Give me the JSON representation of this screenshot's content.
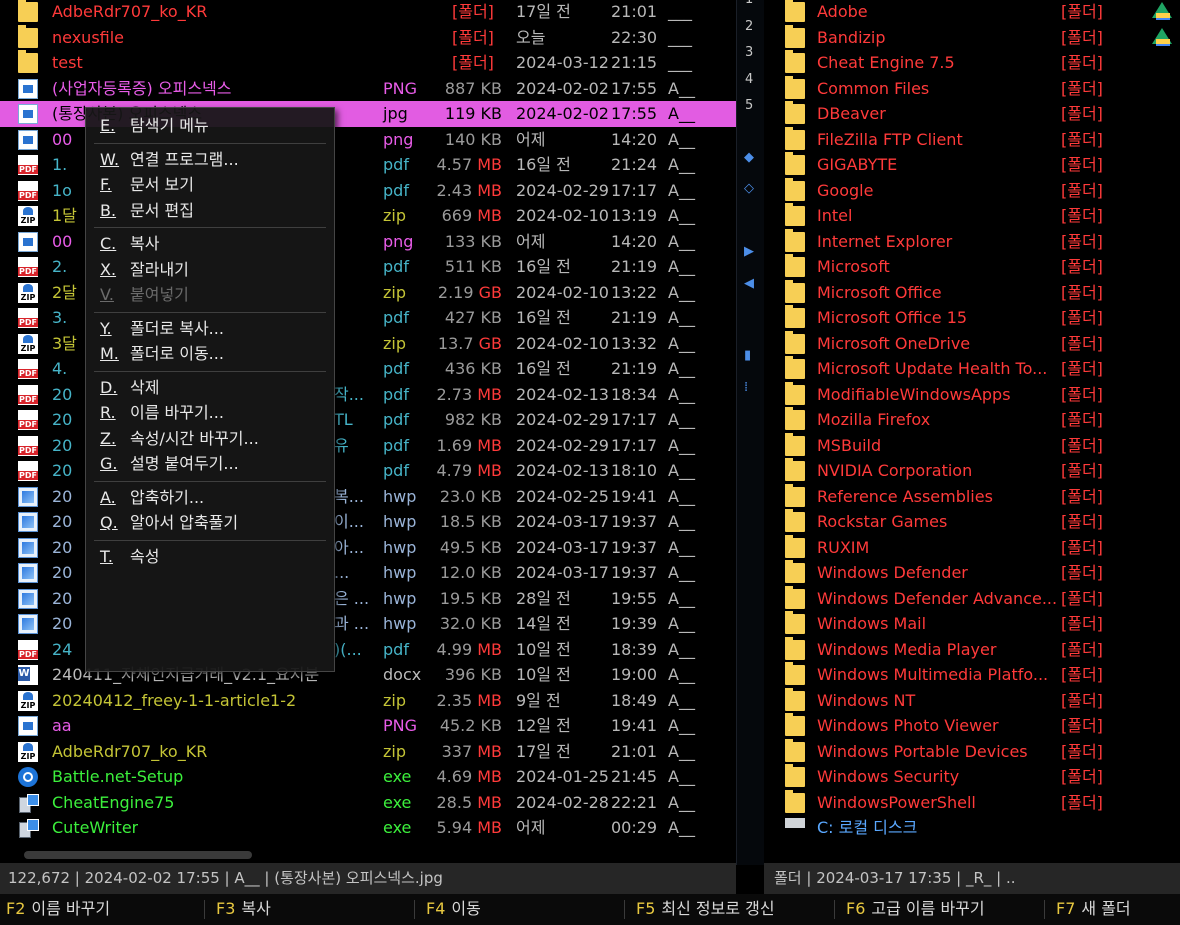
{
  "left_pane": {
    "rows": [
      {
        "name": "AdbeRdr707_ko_KR",
        "ext": "",
        "size": "[폴더]",
        "date": "17일 전",
        "time": "21:01",
        "attr": "___",
        "icon": "folder-icon",
        "color": "red",
        "folder": true
      },
      {
        "name": "nexusfile",
        "ext": "",
        "size": "[폴더]",
        "date": "오늘",
        "time": "22:30",
        "attr": "___",
        "icon": "folder-icon",
        "color": "red",
        "folder": true
      },
      {
        "name": "test",
        "ext": "",
        "size": "[폴더]",
        "date": "2024-03-12",
        "time": "21:15",
        "attr": "___",
        "icon": "folder-icon",
        "color": "red",
        "folder": true
      },
      {
        "name": "(사업자등록증) 오피스넥스",
        "ext": "PNG",
        "size_num": "887",
        "size_unit": "KB",
        "date": "2024-02-02",
        "time": "17:55",
        "attr": "A__",
        "icon": "image-file-icon",
        "color": "magenta"
      },
      {
        "name": "(통장사본) 오피스넥스",
        "ext": "jpg",
        "size_num": "119",
        "size_unit": "KB",
        "date": "2024-02-02",
        "time": "17:55",
        "attr": "A__",
        "icon": "image-file-icon",
        "color": "magenta",
        "selected": true
      },
      {
        "name": "00",
        "ext": "png",
        "size_num": "140",
        "size_unit": "KB",
        "date": "어제",
        "time": "14:20",
        "attr": "A__",
        "icon": "image-file-icon",
        "color": "magenta"
      },
      {
        "name": "1.",
        "ext": "pdf",
        "size_num": "4.57",
        "size_unit": "MB",
        "date": "16일 전",
        "time": "21:24",
        "attr": "A__",
        "icon": "pdf-file-icon",
        "color": "teal"
      },
      {
        "name": "1o",
        "ext": "pdf",
        "size_num": "2.43",
        "size_unit": "MB",
        "date": "2024-02-29",
        "time": "17:17",
        "attr": "A__",
        "icon": "pdf-file-icon",
        "color": "teal"
      },
      {
        "name": "1달",
        "ext": "zip",
        "size_num": "669",
        "size_unit": "MB",
        "date": "2024-02-10",
        "time": "13:19",
        "attr": "A__",
        "icon": "zip-file-icon",
        "color": "olive"
      },
      {
        "name": "00",
        "ext": "png",
        "size_num": "133",
        "size_unit": "KB",
        "date": "어제",
        "time": "14:20",
        "attr": "A__",
        "icon": "image-file-icon",
        "color": "magenta"
      },
      {
        "name": "2.",
        "ext": "pdf",
        "size_num": "511",
        "size_unit": "KB",
        "date": "16일 전",
        "time": "21:19",
        "attr": "A__",
        "icon": "pdf-file-icon",
        "color": "teal"
      },
      {
        "name": "2달",
        "ext": "zip",
        "size_num": "2.19",
        "size_unit": "GB",
        "date": "2024-02-10",
        "time": "13:22",
        "attr": "A__",
        "icon": "zip-file-icon",
        "color": "olive"
      },
      {
        "name": "3.",
        "ext": "pdf",
        "size_num": "427",
        "size_unit": "KB",
        "date": "16일 전",
        "time": "21:19",
        "attr": "A__",
        "icon": "pdf-file-icon",
        "color": "teal"
      },
      {
        "name": "3달",
        "ext": "zip",
        "size_num": "13.7",
        "size_unit": "GB",
        "date": "2024-02-10",
        "time": "13:32",
        "attr": "A__",
        "icon": "zip-file-icon",
        "color": "olive"
      },
      {
        "name": "4.",
        "ext": "pdf",
        "size_num": "436",
        "size_unit": "KB",
        "date": "16일 전",
        "time": "21:19",
        "attr": "A__",
        "icon": "pdf-file-icon",
        "color": "teal"
      },
      {
        "name": "20",
        "ext": "pdf",
        "size_num": "2.73",
        "size_unit": "MB",
        "date": "2024-02-13",
        "time": "18:34",
        "attr": "A__",
        "icon": "pdf-file-icon",
        "color": "teal",
        "trail": "작..."
      },
      {
        "name": "20",
        "ext": "pdf",
        "size_num": "982",
        "size_unit": "KB",
        "date": "2024-02-29",
        "time": "17:17",
        "attr": "A__",
        "icon": "pdf-file-icon",
        "color": "teal",
        "trail": "TL"
      },
      {
        "name": "20",
        "ext": "pdf",
        "size_num": "1.69",
        "size_unit": "MB",
        "date": "2024-02-29",
        "time": "17:17",
        "attr": "A__",
        "icon": "pdf-file-icon",
        "color": "teal",
        "trail": "유"
      },
      {
        "name": "20",
        "ext": "pdf",
        "size_num": "4.79",
        "size_unit": "MB",
        "date": "2024-02-13",
        "time": "18:10",
        "attr": "A__",
        "icon": "pdf-file-icon",
        "color": "teal"
      },
      {
        "name": "20",
        "ext": "hwp",
        "size_num": "23.0",
        "size_unit": "KB",
        "date": "2024-02-25",
        "time": "19:41",
        "attr": "A__",
        "icon": "hwp-file-icon",
        "color": "hwp",
        "trail": "복..."
      },
      {
        "name": "20",
        "ext": "hwp",
        "size_num": "18.5",
        "size_unit": "KB",
        "date": "2024-03-17",
        "time": "19:37",
        "attr": "A__",
        "icon": "hwp-file-icon",
        "color": "hwp",
        "trail": "이..."
      },
      {
        "name": "20",
        "ext": "hwp",
        "size_num": "49.5",
        "size_unit": "KB",
        "date": "2024-03-17",
        "time": "19:37",
        "attr": "A__",
        "icon": "hwp-file-icon",
        "color": "hwp",
        "trail": "아..."
      },
      {
        "name": "20",
        "ext": "hwp",
        "size_num": "12.0",
        "size_unit": "KB",
        "date": "2024-03-17",
        "time": "19:37",
        "attr": "A__",
        "icon": "hwp-file-icon",
        "color": "hwp",
        "trail": "..."
      },
      {
        "name": "20",
        "ext": "hwp",
        "size_num": "19.5",
        "size_unit": "KB",
        "date": "28일 전",
        "time": "19:55",
        "attr": "A__",
        "icon": "hwp-file-icon",
        "color": "hwp",
        "trail": "은 ..."
      },
      {
        "name": "20",
        "ext": "hwp",
        "size_num": "32.0",
        "size_unit": "KB",
        "date": "14일 전",
        "time": "19:39",
        "attr": "A__",
        "icon": "hwp-file-icon",
        "color": "hwp",
        "trail": "과 ..."
      },
      {
        "name": "24",
        "ext": "pdf",
        "size_num": "4.99",
        "size_unit": "MB",
        "date": "10일 전",
        "time": "18:39",
        "attr": "A__",
        "icon": "pdf-file-icon",
        "color": "teal",
        "trail": ")(..."
      },
      {
        "name": "240411_자체인지급거래_v2.1_요지분",
        "ext": "docx",
        "size_num": "396",
        "size_unit": "KB",
        "date": "10일 전",
        "time": "19:00",
        "attr": "A__",
        "icon": "word-file-icon",
        "color": "doc"
      },
      {
        "name": "20240412_freey-1-1-article1-2",
        "ext": "zip",
        "size_num": "2.35",
        "size_unit": "MB",
        "date": "9일 전",
        "time": "18:49",
        "attr": "A__",
        "icon": "zip-file-icon",
        "color": "olive"
      },
      {
        "name": "aa",
        "ext": "PNG",
        "size_num": "45.2",
        "size_unit": "KB",
        "date": "12일 전",
        "time": "19:41",
        "attr": "A__",
        "icon": "image-file-icon",
        "color": "magenta"
      },
      {
        "name": "AdbeRdr707_ko_KR",
        "ext": "zip",
        "size_num": "337",
        "size_unit": "MB",
        "date": "17일 전",
        "time": "21:01",
        "attr": "A__",
        "icon": "zip-file-icon",
        "color": "olive"
      },
      {
        "name": "Battle.net-Setup",
        "ext": "exe",
        "size_num": "4.69",
        "size_unit": "MB",
        "date": "2024-01-25",
        "time": "21:45",
        "attr": "A__",
        "icon": "battlenet-icon",
        "color": "green"
      },
      {
        "name": "CheatEngine75",
        "ext": "exe",
        "size_num": "28.5",
        "size_unit": "MB",
        "date": "2024-02-28",
        "time": "22:21",
        "attr": "A__",
        "icon": "setup-icon",
        "color": "green"
      },
      {
        "name": "CuteWriter",
        "ext": "exe",
        "size_num": "5.94",
        "size_unit": "MB",
        "date": "어제",
        "time": "00:29",
        "attr": "A__",
        "icon": "setup-icon",
        "color": "green"
      }
    ]
  },
  "context_menu": {
    "items": [
      {
        "key": "E.",
        "label": "탐색기 메뉴"
      },
      {
        "sep": true
      },
      {
        "key": "W.",
        "label": "연결 프로그램..."
      },
      {
        "key": "F.",
        "label": "문서 보기"
      },
      {
        "key": "B.",
        "label": "문서 편집"
      },
      {
        "sep": true
      },
      {
        "key": "C.",
        "label": "복사"
      },
      {
        "key": "X.",
        "label": "잘라내기"
      },
      {
        "key": "V.",
        "label": "붙여넣기",
        "disabled": true
      },
      {
        "sep": true
      },
      {
        "key": "Y.",
        "label": "폴더로 복사..."
      },
      {
        "key": "M.",
        "label": "폴더로 이동..."
      },
      {
        "sep": true
      },
      {
        "key": "D.",
        "label": "삭제"
      },
      {
        "key": "R.",
        "label": "이름 바꾸기..."
      },
      {
        "key": "Z.",
        "label": "속성/시간 바꾸기..."
      },
      {
        "key": "G.",
        "label": "설명 붙여두기..."
      },
      {
        "sep": true
      },
      {
        "key": "A.",
        "label": "압축하기..."
      },
      {
        "key": "Q.",
        "label": "알아서 압축풀기"
      },
      {
        "sep": true
      },
      {
        "key": "T.",
        "label": "속성"
      }
    ]
  },
  "divider": {
    "numbers": [
      "1",
      "2",
      "3",
      "4",
      "5"
    ]
  },
  "right_pane": {
    "folder_tag": "[폴더]",
    "rows": [
      "Adobe",
      "Bandizip",
      "Cheat Engine 7.5",
      "Common Files",
      "DBeaver",
      "FileZilla FTP Client",
      "GIGABYTE",
      "Google",
      "Intel",
      "Internet Explorer",
      "Microsoft",
      "Microsoft Office",
      "Microsoft Office 15",
      "Microsoft OneDrive",
      "Microsoft Update Health To...",
      "ModifiableWindowsApps",
      "Mozilla Firefox",
      "MSBuild",
      "NVIDIA Corporation",
      "Reference Assemblies",
      "Rockstar Games",
      "RUXIM",
      "Windows Defender",
      "Windows Defender Advance...",
      "Windows Mail",
      "Windows Media Player",
      "Windows Multimedia Platfo...",
      "Windows NT",
      "Windows Photo Viewer",
      "Windows Portable Devices",
      "Windows Security",
      "WindowsPowerShell"
    ],
    "drive_label": "C: 로컬 디스크"
  },
  "status": {
    "left": "122,672  |  2024-02-02 17:55  |  A__  |  (통장사본) 오피스넥스.jpg",
    "right": "폴더  |  2024-03-17 17:35  |  _R_  |  .."
  },
  "function_keys": [
    {
      "key": "F2",
      "label": "이름 바꾸기"
    },
    {
      "key": "F3",
      "label": "복사"
    },
    {
      "key": "F4",
      "label": "이동"
    },
    {
      "key": "F5",
      "label": "최신 정보로 갱신"
    },
    {
      "key": "F6",
      "label": "고급 이름 바꾸기"
    },
    {
      "key": "F7",
      "label": "새 폴더"
    }
  ],
  "colors": {
    "folder_text": "#ff3a3a",
    "selection": "#e25ce2",
    "image": "#e85ce8",
    "exe": "#3cf03c",
    "zip": "#c4c436",
    "pdf": "#46b4c8",
    "hwp": "#9ab4d8",
    "drive": "#5aa8ff"
  }
}
